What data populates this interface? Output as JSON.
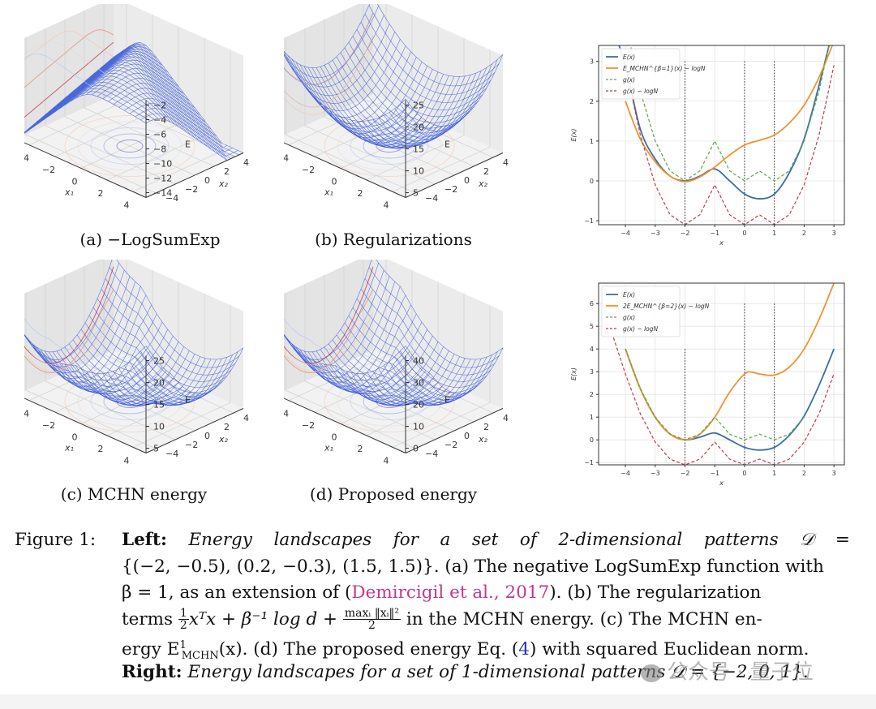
{
  "figure": {
    "subfigures_3d": [
      {
        "id": "a",
        "caption": "(a) −LogSumExp",
        "zlabel": "E",
        "xlabel": "x₁",
        "ylabel": "x₂",
        "zticks": [
          "−2",
          "−4",
          "−6",
          "−8",
          "−10",
          "−12",
          "−14"
        ],
        "xticks": [
          "−4",
          "−2",
          "0",
          "2",
          "4"
        ],
        "yticks": [
          "4",
          "2",
          "0",
          "−2",
          "−4"
        ],
        "surface_shape": "peak"
      },
      {
        "id": "b",
        "caption": "(b) Regularizations",
        "zlabel": "E",
        "xlabel": "x₁",
        "ylabel": "x₂",
        "zticks": [
          "25",
          "20",
          "15",
          "10",
          "5"
        ],
        "xticks": [
          "−4",
          "−2",
          "0",
          "2",
          "4"
        ],
        "yticks": [
          "4",
          "2",
          "0",
          "−2",
          "−4"
        ],
        "surface_shape": "bowl"
      },
      {
        "id": "c",
        "caption": "(c) MCHN energy",
        "zlabel": "E",
        "xlabel": "x₁",
        "ylabel": "x₂",
        "zticks": [
          "25",
          "20",
          "15",
          "10",
          "5"
        ],
        "xticks": [
          "−4",
          "−2",
          "0",
          "2",
          "4"
        ],
        "yticks": [
          "4",
          "2",
          "0",
          "−2",
          "−4"
        ],
        "surface_shape": "bowl-flat"
      },
      {
        "id": "d",
        "caption": "(d) Proposed energy",
        "zlabel": "E",
        "xlabel": "x₁",
        "ylabel": "x₂",
        "zticks": [
          "40",
          "30",
          "20",
          "10",
          "0"
        ],
        "xticks": [
          "−4",
          "−2",
          "0",
          "2",
          "4"
        ],
        "yticks": [
          "4",
          "2",
          "0",
          "−2",
          "−4"
        ],
        "surface_shape": "bowl-flat"
      }
    ],
    "caption": {
      "label": "Figure 1:",
      "left_bold": "Left:",
      "line1_words": [
        "Energy",
        "landscapes",
        "for",
        "a",
        "set",
        "of",
        "2-dimensional",
        "patterns",
        "𝒟",
        "="
      ],
      "line2": "{(−2, −0.5), (0.2, −0.3), (1.5, 1.5)}. (a) The negative LogSumExp function with",
      "line3_pre": "β = 1, as an extension of (",
      "line3_cite": "Demircigil et al., 2017",
      "line3_post": "). (b) The regularization",
      "line4_pre": "terms",
      "line4_half_num": "1",
      "line4_half_den": "2",
      "line4_mid": "xᵀx + β⁻¹ log d +",
      "line4_frac_num": "maxᵢ ‖xᵢ‖²",
      "line4_frac_den": "2",
      "line4_post": "in the MCHN energy. (c) The MCHN en-",
      "line5_pre": "ergy E",
      "line5_sup": "1",
      "line5_sub": "MCHN",
      "line5_mid": "(x). (d) The proposed energy Eq. (",
      "line5_ref": "4",
      "line5_post": ") with squared Euclidean norm.",
      "right_bold": "Right:",
      "line6_italic": "Energy landscapes for a set of 1-dimensional patterns 𝒟 = {−2, 0, 1}."
    },
    "watermark": "公众号 · 量子位"
  },
  "chart_data": [
    {
      "type": "line",
      "title": "",
      "xlabel": "x",
      "ylabel": "E(x)",
      "xlim": [
        -4.9,
        3.35
      ],
      "ylim": [
        -1.1,
        3.4
      ],
      "xticks": [
        -4,
        -3,
        -2,
        -1,
        0,
        1,
        2,
        3
      ],
      "yticks": [
        -1,
        0,
        1,
        2,
        3
      ],
      "grid": true,
      "legend_position": "top-left",
      "patterns": [
        -2,
        0,
        1
      ],
      "vlines": {
        "x": [
          -2,
          0,
          1
        ],
        "ymax": 3.0,
        "style": "dotted"
      },
      "series": [
        {
          "name": "E(x)",
          "color": "#3a6fa6",
          "style": "solid",
          "x": [
            -4.5,
            -4.0,
            -3.5,
            -3.0,
            -2.5,
            -2.0,
            -1.5,
            -1.0,
            -0.5,
            0.0,
            0.5,
            1.0,
            1.5,
            2.0,
            2.5,
            3.0
          ],
          "y": [
            4.0,
            2.9,
            1.3,
            0.55,
            0.12,
            0.0,
            0.12,
            0.3,
            0.0,
            -0.33,
            -0.45,
            -0.33,
            0.2,
            1.05,
            2.4,
            3.9
          ]
        },
        {
          "name": "E_MCHN^{β=1}(x) − logN",
          "color": "#f0922e",
          "style": "solid",
          "x": [
            -4.0,
            -3.5,
            -3.0,
            -2.5,
            -2.0,
            -1.5,
            -1.0,
            -0.5,
            0.0,
            0.5,
            1.0,
            1.5,
            2.0,
            2.5,
            3.0
          ],
          "y": [
            2.0,
            1.05,
            0.48,
            0.12,
            -0.02,
            0.1,
            0.35,
            0.65,
            0.9,
            1.02,
            1.15,
            1.45,
            1.9,
            2.6,
            3.5
          ]
        },
        {
          "name": "g(x)",
          "color": "#5aa845",
          "style": "dashed",
          "x": [
            -4.0,
            -3.5,
            -3.0,
            -2.5,
            -2.0,
            -1.5,
            -1.0,
            -0.5,
            0.0,
            0.5,
            1.0,
            1.5,
            2.0,
            2.5,
            3.0
          ],
          "y": [
            4.0,
            2.25,
            1.0,
            0.25,
            0.0,
            0.25,
            1.0,
            0.25,
            0.0,
            0.25,
            0.0,
            0.25,
            1.0,
            2.25,
            4.0
          ]
        },
        {
          "name": "g(x) − logN",
          "color": "#c23b4a",
          "style": "dashed",
          "x": [
            -4.0,
            -3.5,
            -3.0,
            -2.5,
            -2.0,
            -1.5,
            -1.0,
            -0.5,
            0.0,
            0.5,
            1.0,
            1.5,
            2.0,
            2.5,
            3.0
          ],
          "y": [
            2.9,
            1.15,
            -0.1,
            -0.85,
            -1.1,
            -0.85,
            -0.1,
            -0.85,
            -1.1,
            -0.85,
            -1.1,
            -0.85,
            -0.1,
            1.15,
            2.9
          ]
        }
      ]
    },
    {
      "type": "line",
      "title": "",
      "xlabel": "x",
      "ylabel": "E(x)",
      "xlim": [
        -4.9,
        3.35
      ],
      "ylim": [
        -1.1,
        6.9
      ],
      "xticks": [
        -4,
        -3,
        -2,
        -1,
        0,
        1,
        2,
        3
      ],
      "yticks": [
        -1,
        0,
        1,
        2,
        3,
        4,
        5,
        6
      ],
      "grid": true,
      "legend_position": "top-left",
      "patterns": [
        -2,
        0,
        1
      ],
      "vlines": {
        "x": [
          -2,
          0,
          1
        ],
        "ymax_list": [
          4.0,
          6.0,
          6.0
        ],
        "style": "dotted"
      },
      "series": [
        {
          "name": "E(x)",
          "color": "#3a6fa6",
          "style": "solid",
          "x": [
            -4.0,
            -3.5,
            -3.0,
            -2.5,
            -2.0,
            -1.5,
            -1.0,
            -0.5,
            0.0,
            0.5,
            1.0,
            1.5,
            2.0,
            2.5,
            3.0
          ],
          "y": [
            4.0,
            2.25,
            1.0,
            0.25,
            0.0,
            0.12,
            0.3,
            0.0,
            -0.33,
            -0.45,
            -0.33,
            0.2,
            1.05,
            2.4,
            4.0
          ]
        },
        {
          "name": "2E_MCHN^{β=2}(x) − logN",
          "color": "#f0922e",
          "style": "solid",
          "x": [
            -4.0,
            -3.5,
            -3.0,
            -2.5,
            -2.0,
            -1.5,
            -1.0,
            -0.5,
            0.0,
            0.25,
            0.5,
            1.0,
            1.5,
            2.0,
            2.5,
            3.0
          ],
          "y": [
            4.0,
            2.25,
            1.0,
            0.25,
            0.0,
            0.25,
            1.0,
            2.1,
            2.9,
            2.98,
            2.9,
            2.85,
            3.2,
            4.0,
            5.3,
            6.9
          ]
        },
        {
          "name": "g(x)",
          "color": "#5aa845",
          "style": "dashed",
          "x": [
            -4.0,
            -3.5,
            -3.0,
            -2.5,
            -2.0,
            -1.5,
            -1.0,
            -0.5,
            0.0,
            0.5,
            1.0,
            1.5,
            2.0
          ],
          "y": [
            4.0,
            2.25,
            1.0,
            0.25,
            0.0,
            0.25,
            1.0,
            0.25,
            0.0,
            0.25,
            0.0,
            0.25,
            1.0
          ]
        },
        {
          "name": "g(x) − logN",
          "color": "#c23b4a",
          "style": "dashed",
          "x": [
            -4.4,
            -4.0,
            -3.5,
            -3.0,
            -2.5,
            -2.0,
            -1.5,
            -1.0,
            -0.5,
            0.0,
            0.5,
            1.0,
            1.5,
            2.0,
            2.5,
            3.0
          ],
          "y": [
            4.5,
            2.9,
            1.15,
            -0.1,
            -0.85,
            -1.1,
            -0.85,
            -0.1,
            -0.85,
            -1.1,
            -0.85,
            -1.1,
            -0.85,
            -0.1,
            1.15,
            2.9
          ]
        }
      ]
    }
  ]
}
